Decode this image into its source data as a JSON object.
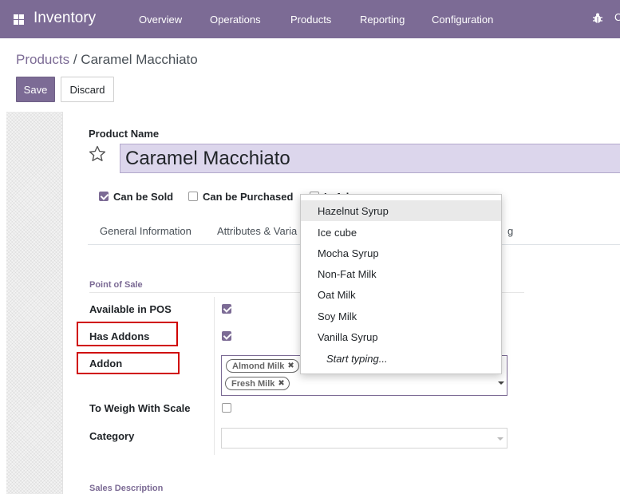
{
  "navbar": {
    "app_name": "Inventory",
    "menu": [
      "Overview",
      "Operations",
      "Products",
      "Reporting",
      "Configuration"
    ],
    "edge_glyph": "C"
  },
  "breadcrumb": {
    "parent": "Products",
    "separator": "/",
    "current": "Caramel Macchiato"
  },
  "buttons": {
    "save": "Save",
    "discard": "Discard"
  },
  "product": {
    "name_label": "Product Name",
    "name_value": "Caramel Macchiato",
    "options": [
      {
        "label": "Can be Sold",
        "checked": true
      },
      {
        "label": "Can be Purchased",
        "checked": false
      },
      {
        "label": "Is Addon",
        "checked": false
      }
    ],
    "options_visible_third": "Is Ad"
  },
  "tabs": {
    "general": "General Information",
    "attributes": "Attributes & Varia",
    "partial_right": "g"
  },
  "pos_section": {
    "title": "Point of Sale",
    "fields": {
      "available_in_pos": {
        "label": "Available in POS",
        "checked": true
      },
      "has_addons": {
        "label": "Has Addons",
        "checked": true
      },
      "addon": {
        "label": "Addon",
        "tags": [
          "Almond Milk",
          "Fresh Milk"
        ]
      },
      "to_weigh": {
        "label": "To Weigh With Scale",
        "checked": false
      },
      "category": {
        "label": "Category",
        "value": ""
      }
    }
  },
  "sales_description": "Sales Description",
  "dropdown": {
    "items": [
      "Hazelnut Syrup",
      "Ice cube",
      "Mocha Syrup",
      "Non-Fat Milk",
      "Oat Milk",
      "Soy Milk",
      "Vanilla Syrup"
    ],
    "hint": "Start typing...",
    "highlighted": "Hazelnut Syrup"
  },
  "colors": {
    "brand": "#7c6b95",
    "highlight_input": "#dcd6ec",
    "annotation_red": "#d00000"
  },
  "icons": {
    "apps": "apps-grid-icon",
    "favorite": "star-outline-icon",
    "debug": "bug-icon",
    "remove_tag": "close-icon",
    "dropdown": "caret-down-icon"
  }
}
